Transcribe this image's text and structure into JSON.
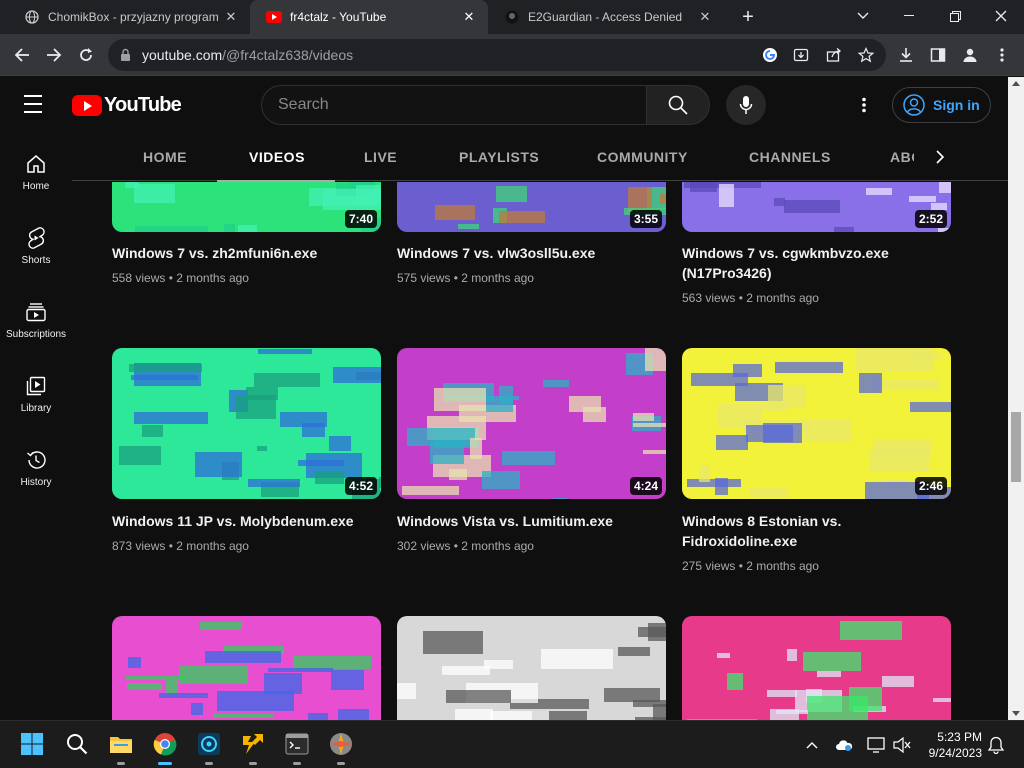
{
  "browser": {
    "tabs": [
      {
        "title": "ChomikBox - przyjazny program",
        "active": false
      },
      {
        "title": "fr4ctalz - YouTube",
        "active": true
      },
      {
        "title": "E2Guardian - Access Denied",
        "active": false
      }
    ],
    "new_tab_label": "+",
    "url_host": "youtube.com",
    "url_path": "/@fr4ctalz638/videos"
  },
  "youtube": {
    "logo_text": "YouTube",
    "search_placeholder": "Search",
    "sign_in_label": "Sign in",
    "sidebar": [
      {
        "label": "Home",
        "icon": "home-icon"
      },
      {
        "label": "Shorts",
        "icon": "shorts-icon"
      },
      {
        "label": "Subscriptions",
        "icon": "subscriptions-icon"
      },
      {
        "label": "Library",
        "icon": "library-icon"
      },
      {
        "label": "History",
        "icon": "history-icon"
      }
    ],
    "channel_tabs": [
      "HOME",
      "VIDEOS",
      "LIVE",
      "PLAYLISTS",
      "COMMUNITY",
      "CHANNELS",
      "ABO"
    ],
    "active_channel_tab": "VIDEOS",
    "videos": [
      {
        "title": "Windows 7 vs. zh2mfuni6n.exe",
        "views": "558 views",
        "age": "2 months ago",
        "duration": "7:40",
        "colors": [
          "#2be37a",
          "#43f0b4",
          "#1fd08a"
        ]
      },
      {
        "title": "Windows 7 vs. vlw3osll5u.exe",
        "views": "575 views",
        "age": "2 months ago",
        "duration": "3:55",
        "colors": [
          "#6b5fd0",
          "#3fd67a",
          "#c07a3a"
        ]
      },
      {
        "title": "Windows 7 vs. cgwkmbvzo.exe (N17Pro3426)",
        "views": "563 views",
        "age": "2 months ago",
        "duration": "2:52",
        "colors": [
          "#8a70e8",
          "#e9e0ff",
          "#5a4ab8"
        ]
      },
      {
        "title": "Windows 11 JP vs. Molybdenum.exe",
        "views": "873 views",
        "age": "2 months ago",
        "duration": "4:52",
        "colors": [
          "#2ee89a",
          "#1aa07c",
          "#2f6fd8"
        ]
      },
      {
        "title": "Windows Vista vs. Lumitium.exe",
        "views": "302 views",
        "age": "2 months ago",
        "duration": "4:24",
        "colors": [
          "#c43fc9",
          "#2bb2c4",
          "#e8e0b0"
        ]
      },
      {
        "title": "Windows 8 Estonian vs. Fidroxidoline.exe",
        "views": "275 views",
        "age": "2 months ago",
        "duration": "2:46",
        "colors": [
          "#f2f23a",
          "#e8e86a",
          "#5a6ad8"
        ]
      },
      {
        "title": "",
        "views": "",
        "age": "",
        "duration": "",
        "colors": [
          "#e84fd0",
          "#3a6ae8",
          "#2fd05a"
        ]
      },
      {
        "title": "",
        "views": "",
        "age": "",
        "duration": "",
        "colors": [
          "#d8d8d8",
          "#5a5a5a",
          "#ffffff"
        ]
      },
      {
        "title": "",
        "views": "",
        "age": "",
        "duration": "",
        "colors": [
          "#e83a8a",
          "#3ae86a",
          "#dfe8f5"
        ]
      }
    ]
  },
  "taskbar": {
    "time": "5:23 PM",
    "date": "9/24/2023"
  }
}
